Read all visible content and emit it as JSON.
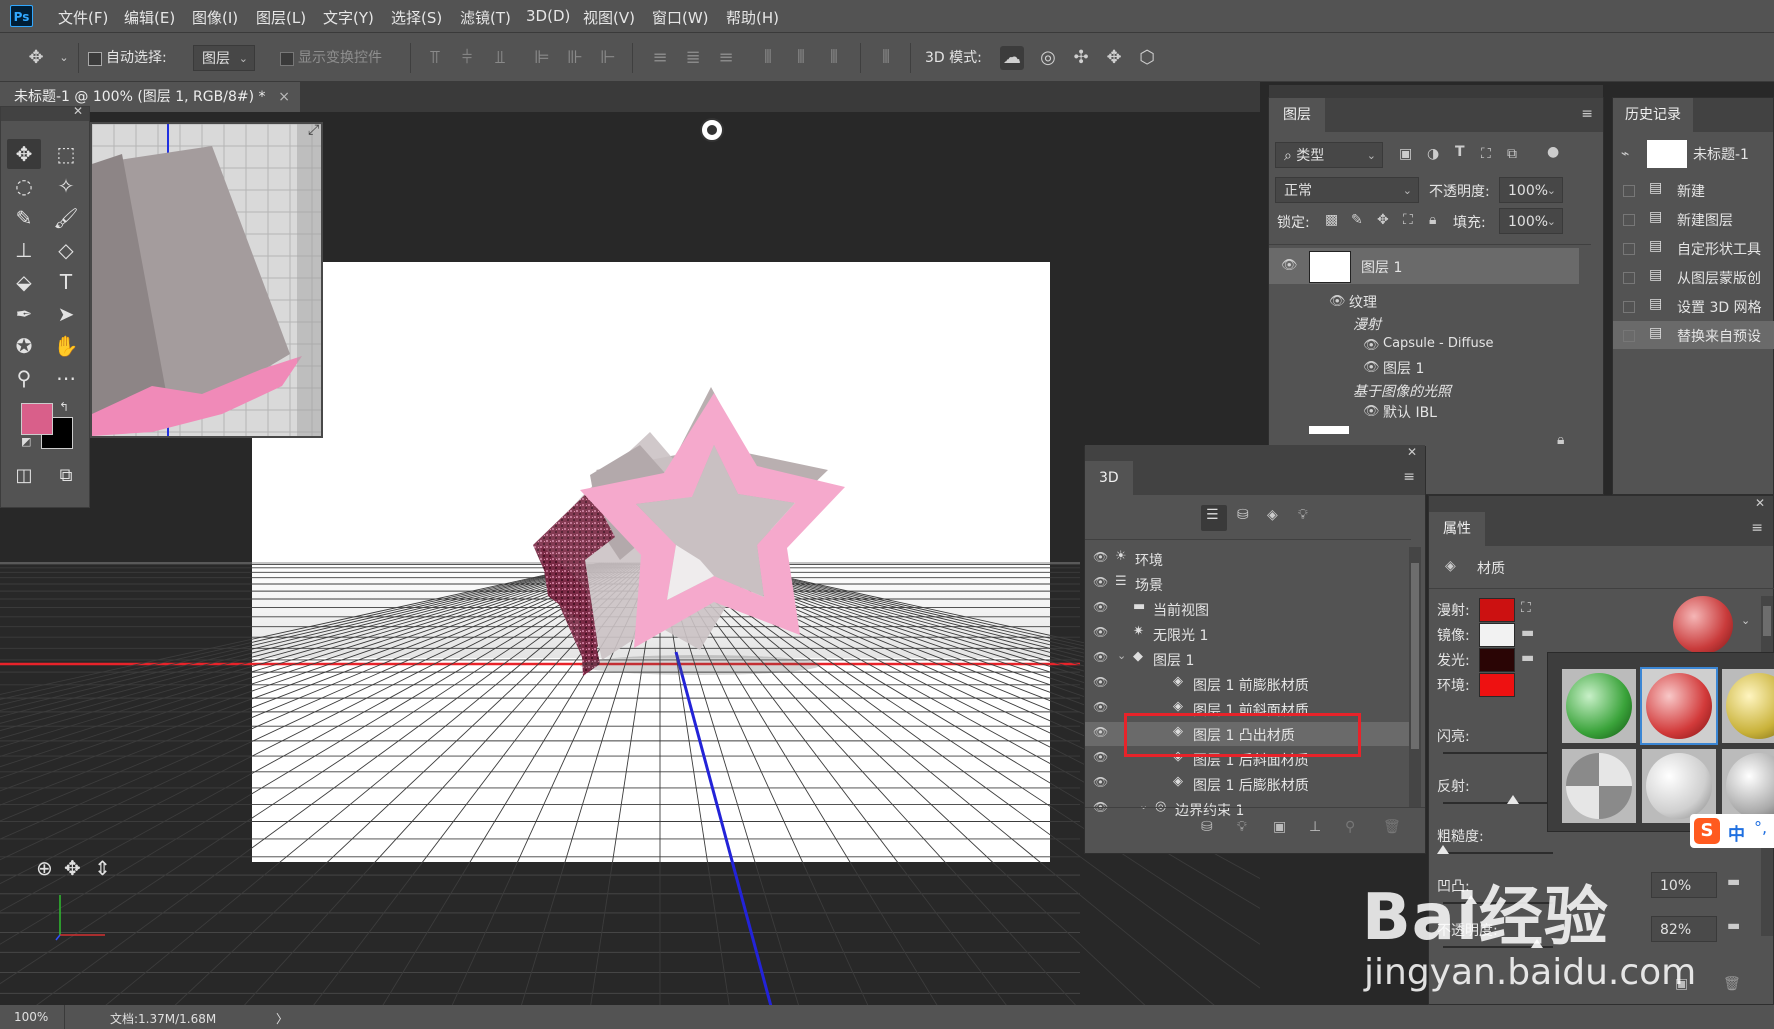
{
  "app": {
    "logo": "Ps"
  },
  "menu": [
    "文件(F)",
    "编辑(E)",
    "图像(I)",
    "图层(L)",
    "文字(Y)",
    "选择(S)",
    "滤镜(T)",
    "3D(D)",
    "视图(V)",
    "窗口(W)",
    "帮助(H)"
  ],
  "options": {
    "auto_select_label": "自动选择:",
    "auto_select_value": "图层",
    "show_transform_label": "显示变换控件",
    "mode_label": "3D 模式:"
  },
  "document": {
    "tab_title": "未标题-1 @ 100% (图层 1, RGB/8#) *",
    "close": "×"
  },
  "colors": {
    "foreground": "#d95f8a",
    "background": "#000000",
    "accent_red": "#e8232a"
  },
  "status": {
    "zoom": "100%",
    "doc": "文档:1.37M/1.68M",
    "arrow": "〉"
  },
  "layers_panel": {
    "tab": "图层",
    "filter": "类型",
    "blend": "正常",
    "opacity_label": "不透明度:",
    "opacity": "100%",
    "lock_label": "锁定:",
    "fill_label": "填充:",
    "fill": "100%",
    "layer_name": "图层 1",
    "texture": "纹理",
    "diffuse": "漫射",
    "capsule": "Capsule - Diffuse",
    "sub_layer": "图层 1",
    "ibl": "基于图像的光照",
    "default_ibl": "默认 IBL"
  },
  "history_panel": {
    "tab": "历史记录",
    "snapshot": "未标题-1",
    "items": [
      "新建",
      "新建图层",
      "自定形状工具",
      "从图层蒙版创",
      "设置 3D 网格",
      "替换来自预设"
    ]
  },
  "panel3d": {
    "tab": "3D",
    "items": [
      {
        "label": "环境",
        "icon": "environment-icon"
      },
      {
        "label": "场景",
        "icon": "scene-icon"
      },
      {
        "label": "当前视图",
        "icon": "camera-icon"
      },
      {
        "label": "无限光 1",
        "icon": "light-icon"
      },
      {
        "label": "图层 1",
        "icon": "mesh-icon"
      },
      {
        "label": "图层 1 前膨胀材质",
        "icon": "material-icon"
      },
      {
        "label": "图层 1 前斜面材质",
        "icon": "material-icon"
      },
      {
        "label": "图层 1 凸出材质",
        "icon": "material-icon"
      },
      {
        "label": "图层 1 后斜面材质",
        "icon": "material-icon"
      },
      {
        "label": "图层 1 后膨胀材质",
        "icon": "material-icon"
      },
      {
        "label": "边界约束 1",
        "icon": "constraint-icon"
      }
    ]
  },
  "properties": {
    "tab": "属性",
    "section": "材质",
    "diffuse_label": "漫射:",
    "specular_label": "镜像:",
    "glow_label": "发光:",
    "ambient_label": "环境:",
    "shine_label": "闪亮:",
    "reflect_label": "反射:",
    "rough_label": "粗糙度:",
    "bump_label": "凹凸:",
    "bump_value": "10%",
    "opacity_label": "不透明度:",
    "opacity_value": "82%",
    "swatches": {
      "diffuse": "#cc1111",
      "specular": "#f2f2f2",
      "glow": "#2a0505",
      "ambient": "#ee1111"
    }
  },
  "ime": {
    "label": "中"
  },
  "watermark": {
    "brand": "Bai经验",
    "url": "jingyan.baidu.com"
  }
}
